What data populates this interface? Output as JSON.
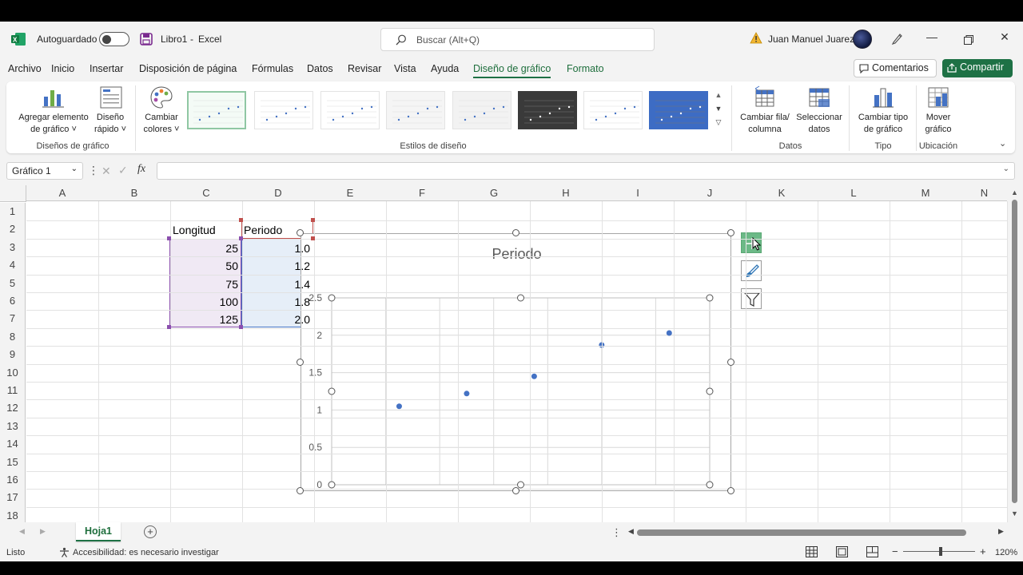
{
  "titlebar": {
    "autosave_label": "Autoguardado",
    "doc_title": "Libro1",
    "separator": "-",
    "app_name": "Excel",
    "search_placeholder": "Buscar (Alt+Q)",
    "user_name": "Juan Manuel Juarez"
  },
  "menu": {
    "items": [
      "Archivo",
      "Inicio",
      "Insertar",
      "Disposición de página",
      "Fórmulas",
      "Datos",
      "Revisar",
      "Vista",
      "Ayuda",
      "Diseño de gráfico",
      "Formato"
    ],
    "active": "Diseño de gráfico",
    "comments_label": "Comentarios",
    "share_label": "Compartir"
  },
  "ribbon": {
    "add_element_label": "Agregar elemento",
    "add_element_label2": "de gráfico",
    "quick_layout_label": "Diseño",
    "quick_layout_label2": "rápido",
    "change_colors_label": "Cambiar",
    "change_colors_label2": "colores",
    "group_layouts": "Diseños de gráfico",
    "group_styles": "Estilos de diseño",
    "switch_row_col_label": "Cambiar fila/",
    "switch_row_col_label2": "columna",
    "select_data_label": "Seleccionar",
    "select_data_label2": "datos",
    "group_data": "Datos",
    "change_type_label": "Cambiar tipo",
    "change_type_label2": "de gráfico",
    "group_type": "Tipo",
    "move_chart_label": "Mover",
    "move_chart_label2": "gráfico",
    "group_location": "Ubicación"
  },
  "formula_bar": {
    "name_box": "Gráfico 1",
    "fx": "fx",
    "value": ""
  },
  "sheet": {
    "columns": [
      "A",
      "B",
      "C",
      "D",
      "E",
      "F",
      "G",
      "H",
      "I",
      "J",
      "K",
      "L",
      "M",
      "N"
    ],
    "rows": [
      "1",
      "2",
      "3",
      "4",
      "5",
      "6",
      "7",
      "8",
      "9",
      "10",
      "11",
      "12",
      "13",
      "14",
      "15",
      "16",
      "17",
      "18"
    ],
    "header_c": "Longitud",
    "header_d": "Periodo",
    "c_values": [
      "25",
      "50",
      "75",
      "100",
      "125"
    ],
    "d_values_visible": [
      "1.0",
      "1.2",
      "1.4",
      "1.8",
      "2.0"
    ]
  },
  "chart_data": {
    "type": "scatter",
    "title": "Periodo",
    "x": [
      25,
      50,
      75,
      100,
      125
    ],
    "y": [
      1.05,
      1.22,
      1.45,
      1.87,
      2.03
    ],
    "xlim": [
      0,
      140
    ],
    "ylim": [
      0,
      2.5
    ],
    "xticks": [
      "0",
      "20",
      "40",
      "60",
      "80",
      "100",
      "120",
      "140"
    ],
    "yticks": [
      "0",
      "0.5",
      "1",
      "1.5",
      "2",
      "2.5"
    ],
    "grid": true,
    "legend": "none",
    "marker_color": "#4472c4"
  },
  "sheet_tabs": {
    "active": "Hoja1"
  },
  "status": {
    "ready": "Listo",
    "accessibility": "Accesibilidad: es necesario investigar",
    "zoom": "120%"
  },
  "colors": {
    "excel_green": "#1e7145",
    "selection_purple": "#7e3fa0",
    "selection_blue": "#4472c4",
    "selection_red": "#c0504d"
  }
}
